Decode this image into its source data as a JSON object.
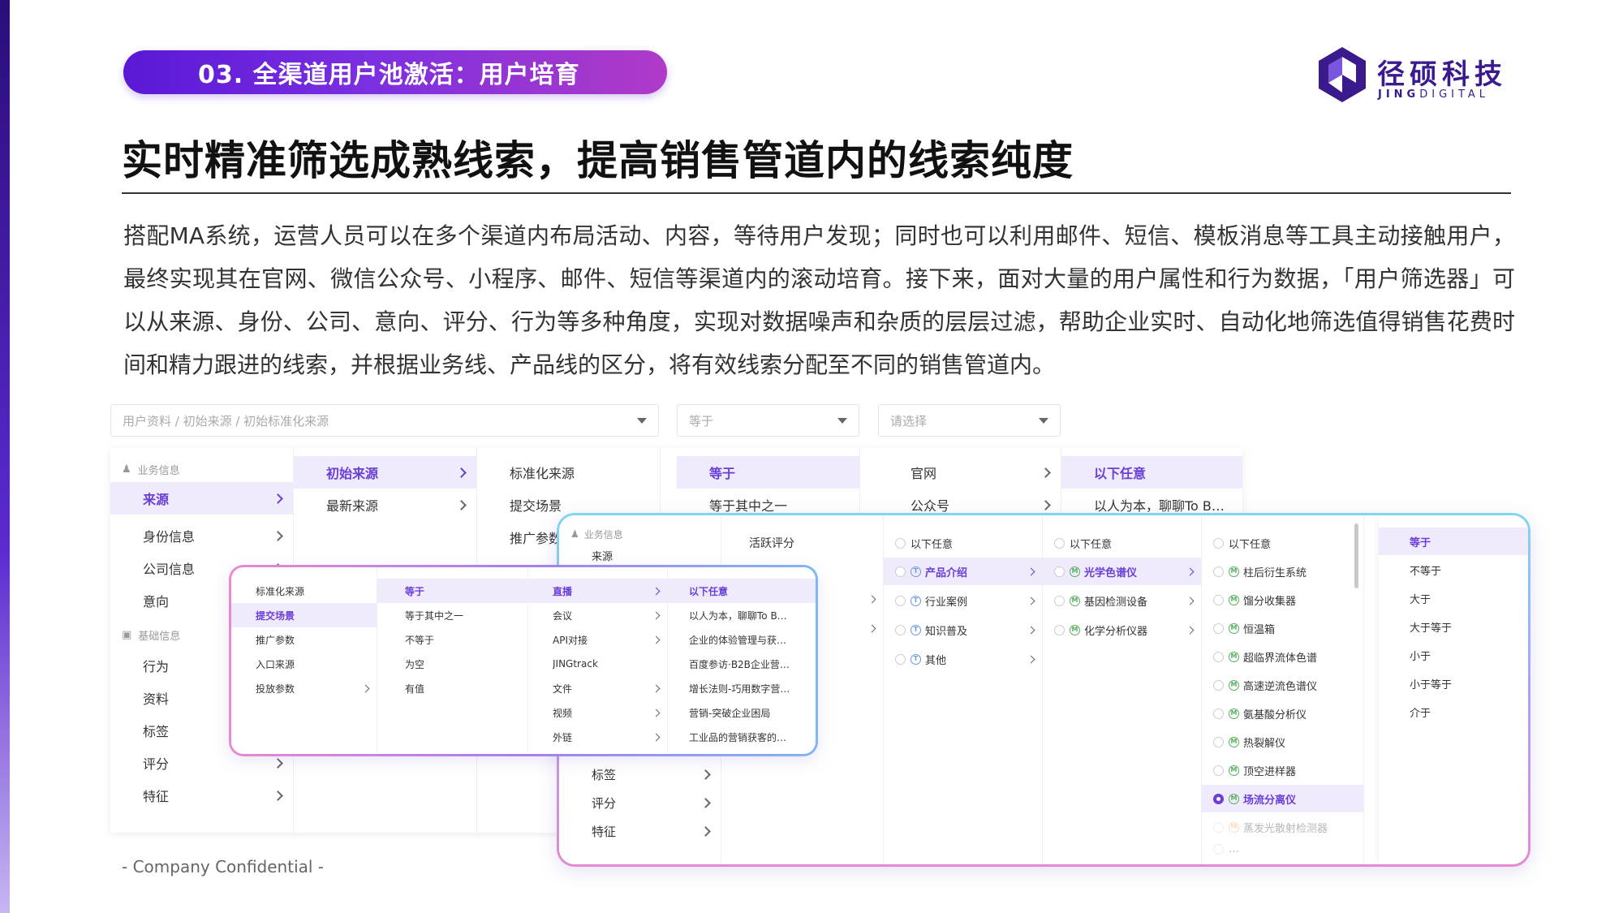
{
  "section": {
    "label": "03. 全渠道用户池激活：用户培育"
  },
  "brand": {
    "name_cn": "径硕科技",
    "name_en_bold": "JING",
    "name_en_rest": "DIGITAL",
    "color": "#3a1a8c"
  },
  "headline": "实时精准筛选成熟线索，提高销售管道内的线索纯度",
  "body": "搭配MA系统，运营人员可以在多个渠道内布局活动、内容，等待用户发现；同时也可以利用邮件、短信、模板消息等工具主动接触用户，最终实现其在官网、微信公众号、小程序、邮件、短信等渠道内的滚动培育。接下来，面对大量的用户属性和行为数据，「用户筛选器」可以从来源、身份、公司、意向、评分、行为等多种角度，实现对数据噪声和杂质的层层过滤，帮助企业实时、自动化地筛选值得销售花费时间和精力跟进的线索，并根据业务线、产品线的区分，将有效线索分配至不同的销售管道内。",
  "footer": "- Company Confidential -",
  "colors": {
    "accent": "#6a3fd8",
    "pill_start": "#5a18d6",
    "pill_end": "#b03ac8"
  },
  "filters": {
    "path_placeholder": "用户资料 / 初始来源 / 初始标准化来源",
    "operator_placeholder": "等于",
    "value_placeholder": "请选择"
  },
  "back_panel": {
    "group1": "业务信息",
    "group2": "基础信息",
    "col1": [
      "来源",
      "身份信息",
      "公司信息",
      "意向",
      "行为",
      "资料",
      "标签",
      "评分",
      "特征"
    ],
    "col2": [
      "初始来源",
      "最新来源"
    ],
    "col3": [
      "标准化来源",
      "提交场景",
      "推广参数",
      "入口来源"
    ],
    "col4": [
      "等于",
      "等于其中之一"
    ],
    "col5": [
      "官网",
      "公众号"
    ],
    "col6": [
      "以下任意",
      "以人为本，聊聊To B…"
    ]
  },
  "mid_panel": {
    "col1": [
      "标准化来源",
      "提交场景",
      "推广参数",
      "入口来源",
      "投放参数"
    ],
    "col2": [
      "等于",
      "等于其中之一",
      "不等于",
      "为空",
      "有值"
    ],
    "col3": [
      "直播",
      "会议",
      "API对接",
      "JINGtrack",
      "文件",
      "视频",
      "外链"
    ],
    "col4": [
      "以下任意",
      "以人为本，聊聊To B…",
      "企业的体验管理与获…",
      "百度参访·B2B企业营…",
      "增长法则-巧用数字营…",
      "营销-突破企业困局",
      "工业品的营销获客的…"
    ]
  },
  "big_panel": {
    "group1": "业务信息",
    "col1": [
      "来源",
      "标签",
      "评分",
      "特征"
    ],
    "col2": [
      "活跃评分"
    ],
    "col3": [
      "以下任意",
      "产品介绍",
      "行业案例",
      "知识普及",
      "其他"
    ],
    "col4": [
      "以下任意",
      "光学色谱仪",
      "基因检测设备",
      "化学分析仪器"
    ],
    "col5": [
      "以下任意",
      "柱后衍生系统",
      "馏分收集器",
      "恒温箱",
      "超临界流体色谱",
      "高速逆流色谱仪",
      "氨基酸分析仪",
      "热裂解仪",
      "顶空进样器",
      "场流分离仪",
      "蒸发光散射检测器",
      "…"
    ],
    "col6": [
      "等于",
      "不等于",
      "大于",
      "大于等于",
      "小于",
      "小于等于",
      "介于"
    ]
  }
}
